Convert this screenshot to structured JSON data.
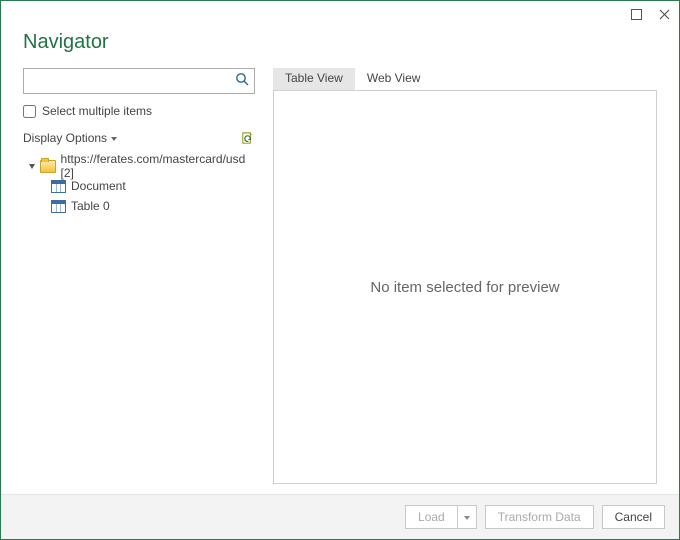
{
  "window": {
    "title": "Navigator"
  },
  "search": {
    "placeholder": ""
  },
  "options": {
    "select_multiple_label": "Select multiple items",
    "display_options_label": "Display Options"
  },
  "tree": {
    "root_label": "https://ferates.com/mastercard/usd [2]",
    "items": [
      {
        "label": "Document"
      },
      {
        "label": "Table 0"
      }
    ]
  },
  "tabs": {
    "table_view": "Table View",
    "web_view": "Web View"
  },
  "preview": {
    "empty_message": "No item selected for preview"
  },
  "footer": {
    "load": "Load",
    "transform": "Transform Data",
    "cancel": "Cancel"
  }
}
